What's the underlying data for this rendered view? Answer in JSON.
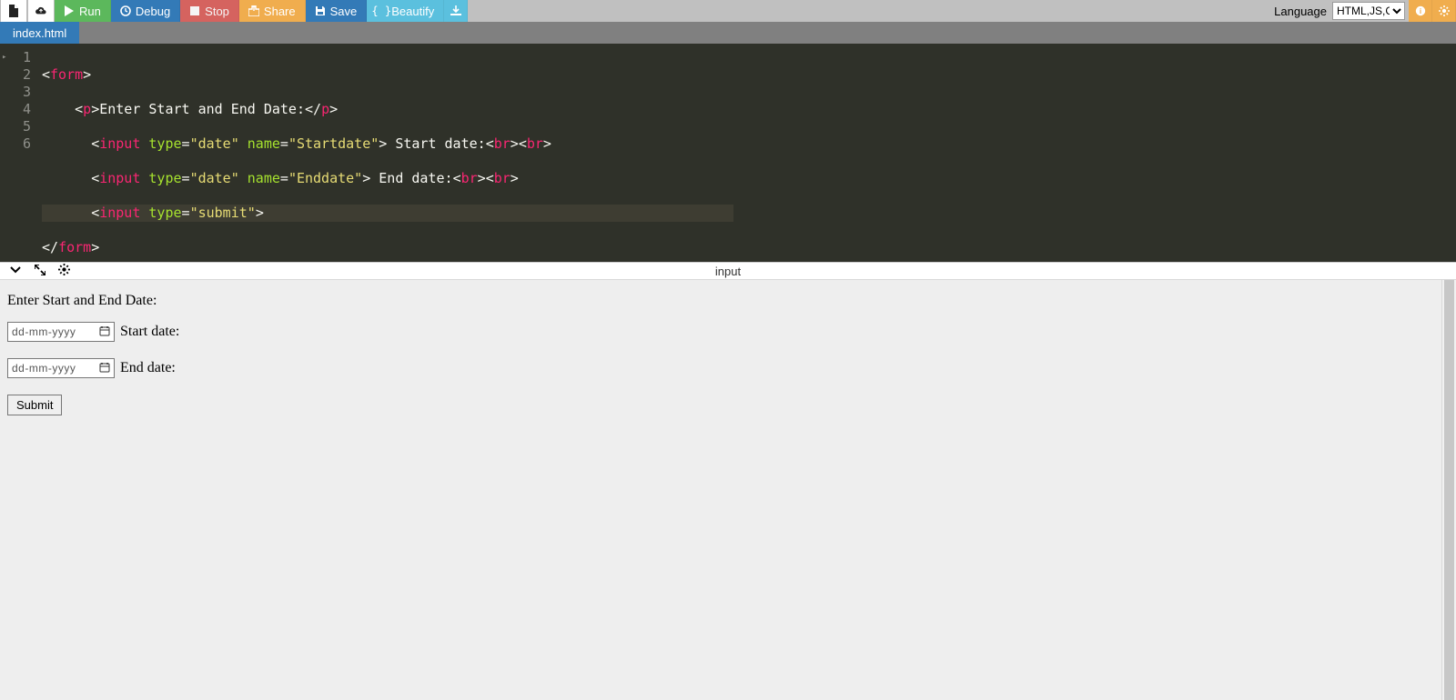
{
  "toolbar": {
    "run": "Run",
    "debug": "Debug",
    "stop": "Stop",
    "share": "Share",
    "save": "Save",
    "beautify": "Beautify",
    "language_label": "Language",
    "language_value": "HTML,JS,CSS"
  },
  "tabs": {
    "file": "index.html"
  },
  "editor": {
    "lines": [
      "1",
      "2",
      "3",
      "4",
      "5",
      "6"
    ],
    "source": {
      "l1": {
        "tag": "form"
      },
      "l2": {
        "tag": "p",
        "text": "Enter Start and End Date:"
      },
      "l3": {
        "tag": "input",
        "attr_type": "type",
        "val_type": "\"date\"",
        "attr_name": "name",
        "val_name": "\"Startdate\"",
        "trail": " Start date:",
        "br": "br"
      },
      "l4": {
        "tag": "input",
        "attr_type": "type",
        "val_type": "\"date\"",
        "attr_name": "name",
        "val_name": "\"Enddate\"",
        "trail": " End date:",
        "br": "br"
      },
      "l5": {
        "tag": "input",
        "attr_type": "type",
        "val_type": "\"submit\""
      },
      "l6": {
        "tag": "form"
      }
    }
  },
  "output": {
    "title": "input",
    "heading": "Enter Start and End Date:",
    "placeholder": "dd-mm-yyyy",
    "start_label": "Start date:",
    "end_label": "End date:",
    "submit": "Submit"
  }
}
